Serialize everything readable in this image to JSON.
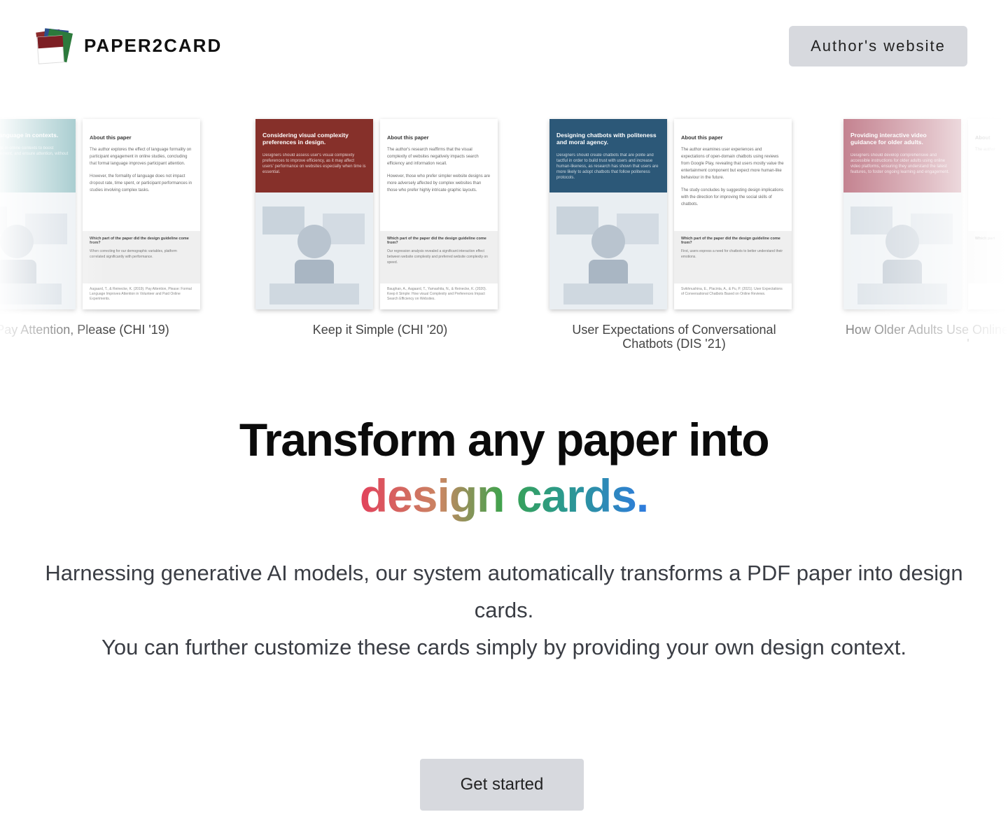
{
  "header": {
    "brand": "PAPER2CARD",
    "author_button": "Author's website"
  },
  "carousel": [
    {
      "caption": "Pay Attention, Please (CHI '19)",
      "front_title": "Use formal language in contexts.",
      "front_desc": "Use formal language in online contexts to boost participants' engagement, and ensure attention, without",
      "back_label": "About this paper",
      "back_text": "The author explores the effect of language formality on participant engagement in online studies, concluding that formal language improves participant attention.",
      "back_text2": "However, the formality of language does not impact dropout rate, time spent, or participant performances in studies involving complex tasks.",
      "question": "Which part of the paper did the design guideline come from?",
      "answer": "When correcting for our demographic variables, platform correlated significantly with performance.",
      "reference": "Aagaard, T., & Reinecke, K. (2019). Pay Attention, Please: Formal Language Improves Attention in Volunteer and Paid Online Experiments.",
      "color": "#8bbcc0"
    },
    {
      "caption": "Keep it Simple (CHI '20)",
      "front_title": "Considering visual complexity preferences in design.",
      "front_desc": "Designers should assess user's visual complexity preferences to improve efficiency, as it may affect users' performance on websites especially when time is essential.",
      "back_label": "About this paper",
      "back_text": "The author's research reaffirms that the visual complexity of websites negatively impacts search efficiency and information recall.",
      "back_text2": "However, those who prefer simpler website designs are more adversely affected by complex websites than those who prefer highly intricate graphic layouts.",
      "question": "Which part of the paper did the design guideline come from?",
      "answer": "Our regression analysis revealed a significant interaction effect between website complexity and preferred website complexity on speed.",
      "reference": "Baughan, A., Aagaard, T., Yamashita, N., & Reinecke, K. (2020). Keep it Simple: How visual Complexity and Preferences Impact Search Efficiency on Websites.",
      "color": "#86302a"
    },
    {
      "caption": "User Expectations of Conversational Chatbots (DIS '21)",
      "front_title": "Designing chatbots with politeness and moral agency.",
      "front_desc": "Designers should create chatbots that are polite and tactful in order to build trust with users and increase human-likeness, as research has shown that users are more likely to adopt chatbots that follow politeness protocols.",
      "back_label": "About this paper",
      "back_text": "The author examines user experiences and expectations of open-domain chatbots using reviews from Google Play, revealing that users mostly value the entertainment component but expect more human-like behaviour in the future.",
      "back_text2": "The study concludes by suggesting design implications with the direction for improving the social skills of chatbots.",
      "question": "Which part of the paper did the design guideline come from?",
      "answer": "First, users express a need for chatbots to better understand their emotions.",
      "reference": "Svikhnushina, E., Placinta, A., & Pu, P. (2021). User Expectations of Conversational Chatbots Based on Online Reviews.",
      "color": "#2c5878"
    },
    {
      "caption": "How Older Adults Use Online Learning (CHI '",
      "front_title": "Providing interactive video guidance for older adults.",
      "front_desc": "Designers should develop comprehensive and accessible instructions for older adults using online video platforms, ensuring they understand the latest features, to foster ongoing learning and engagement.",
      "back_label": "About",
      "back_text": "The author",
      "back_text2": "",
      "question": "Which part",
      "answer": "",
      "reference": "",
      "color": "#a8485c"
    }
  ],
  "hero": {
    "line1": "Transform any paper into",
    "line2": "design cards."
  },
  "description": {
    "line1": "Harnessing generative AI models, our system automatically transforms a PDF paper into design cards.",
    "line2": "You can further customize these cards simply by providing your own design context."
  },
  "cta": {
    "label": "Get started"
  }
}
